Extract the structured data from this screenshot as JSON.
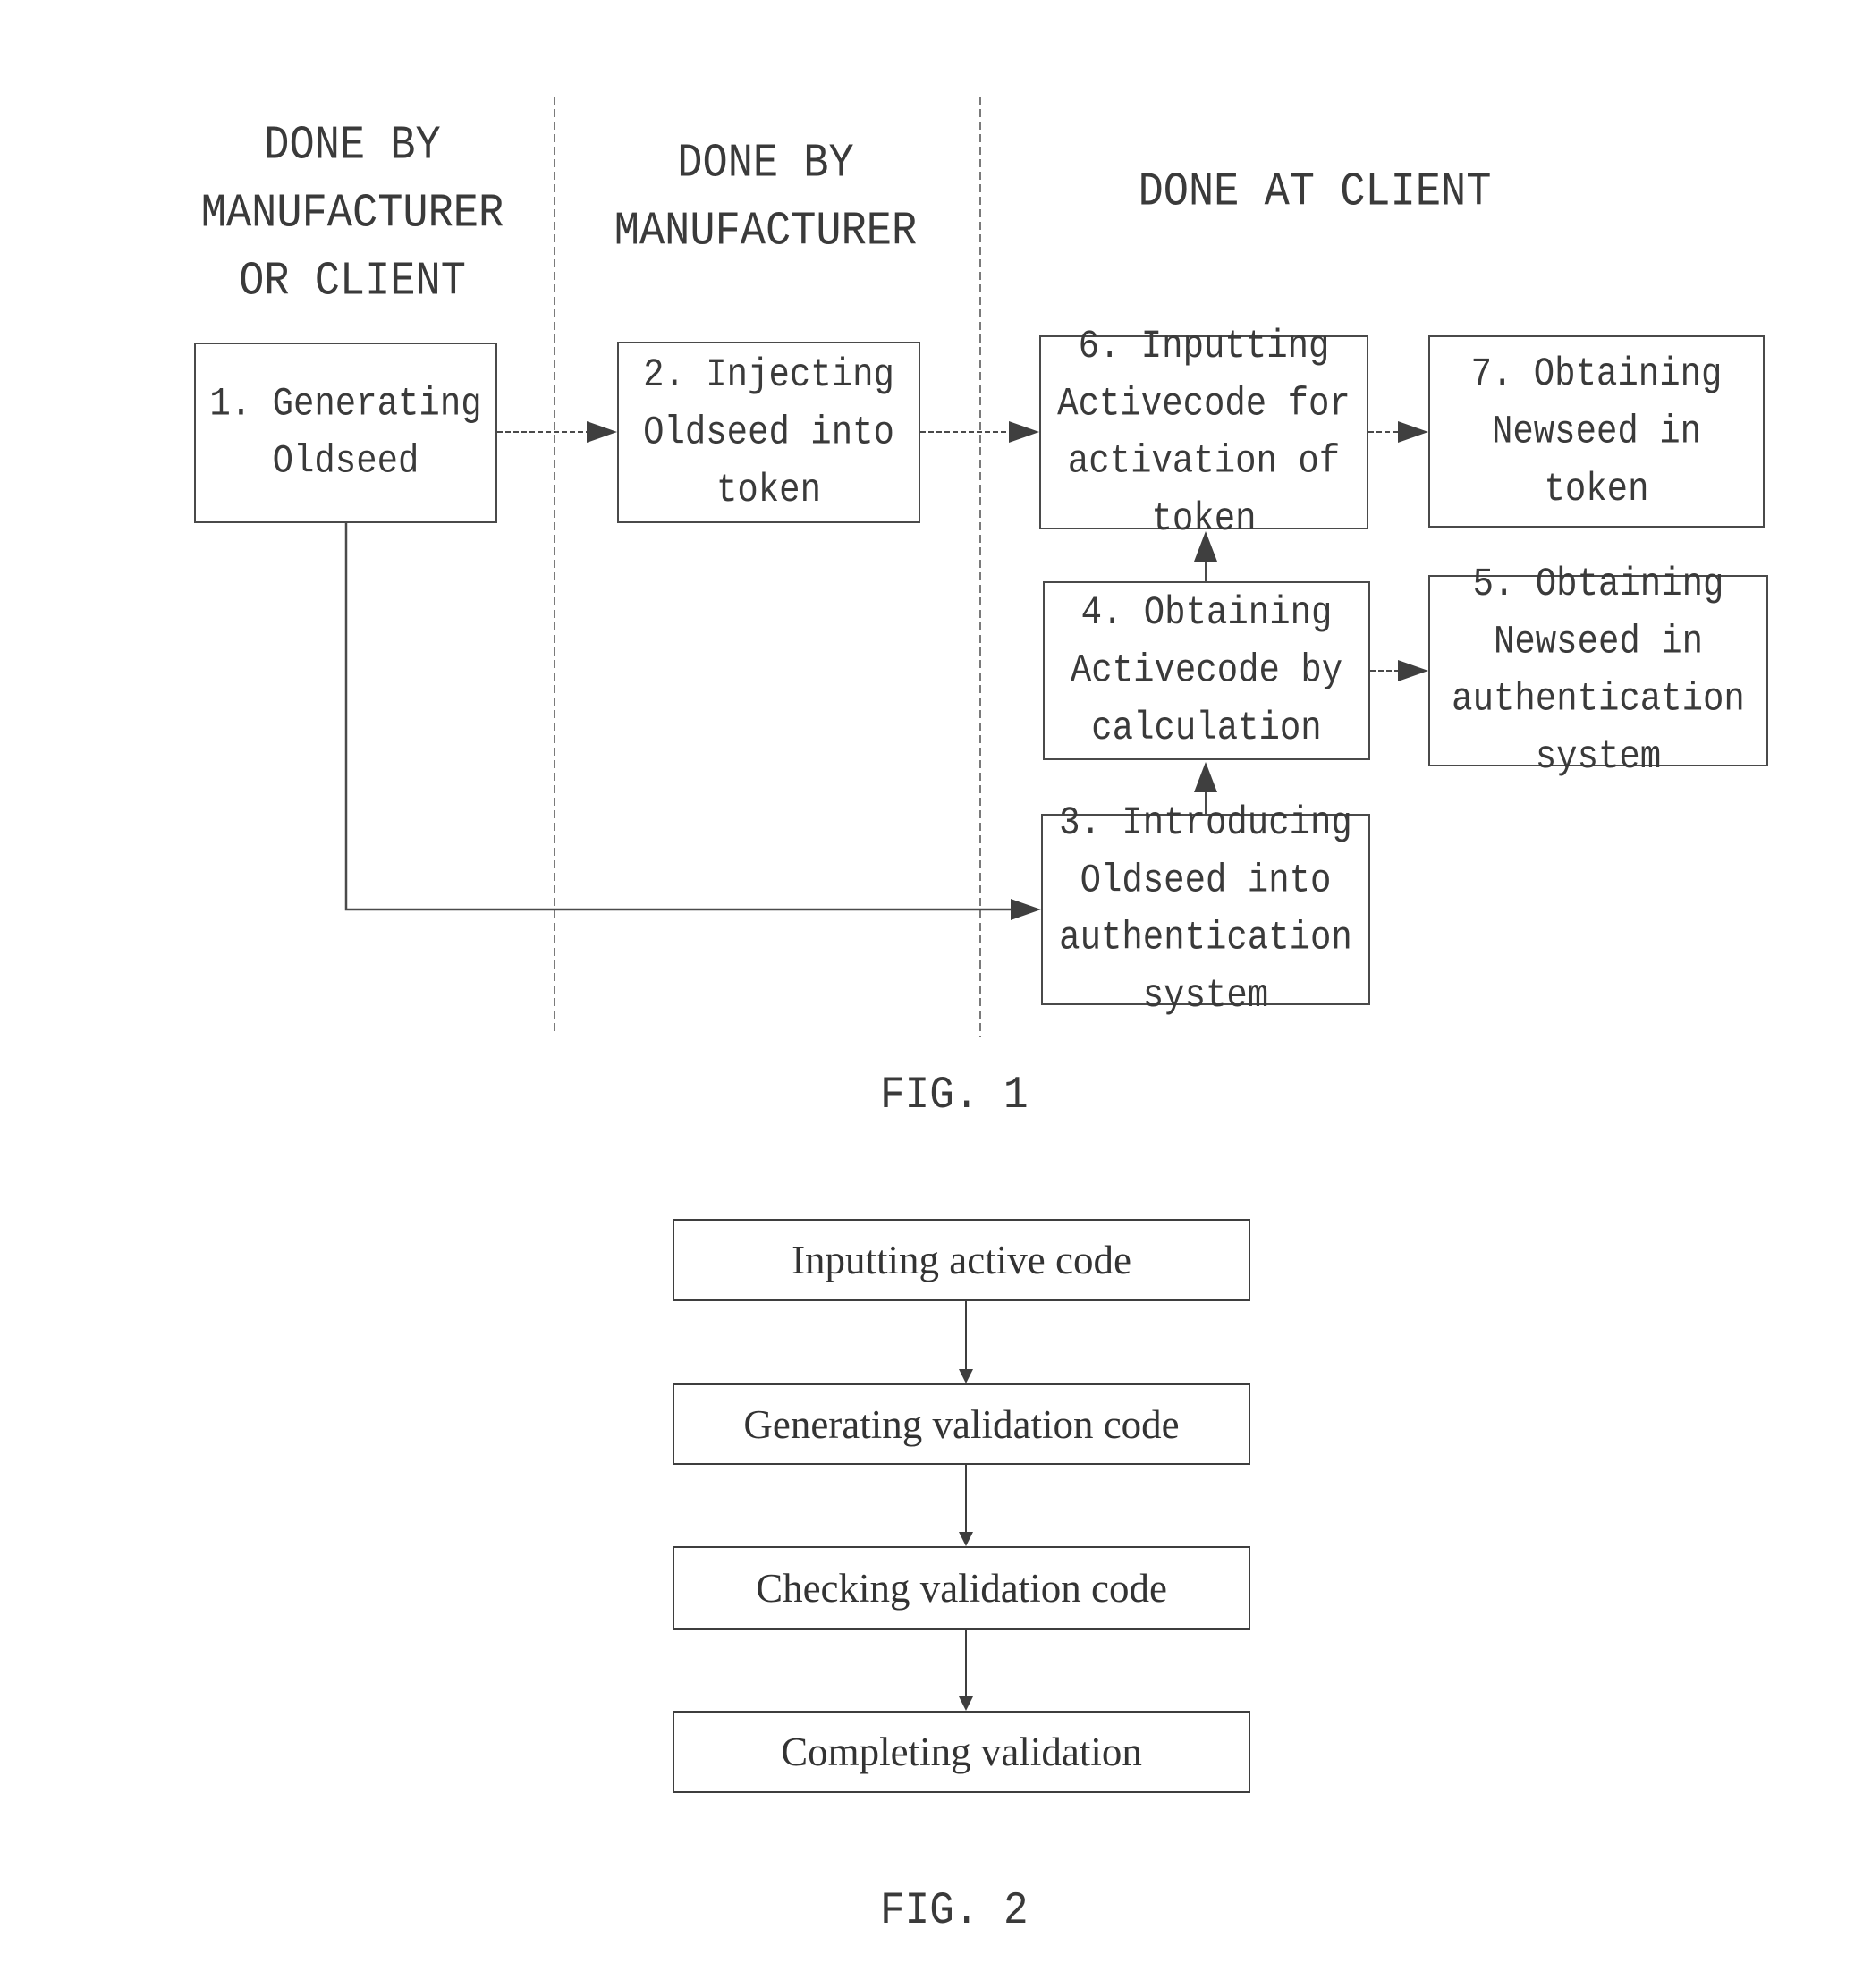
{
  "figure1": {
    "caption": "FIG. 1",
    "lanes": [
      {
        "header_lines": [
          "DONE BY",
          "MANUFACTURER",
          "OR CLIENT"
        ]
      },
      {
        "header_lines": [
          "DONE BY",
          "MANUFACTURER"
        ]
      },
      {
        "header_lines": [
          "DONE AT CLIENT"
        ]
      }
    ],
    "steps": [
      {
        "id": 1,
        "lines": [
          "1. Generating",
          "Oldseed"
        ]
      },
      {
        "id": 2,
        "lines": [
          "2. Injecting",
          "Oldseed into",
          "token"
        ]
      },
      {
        "id": 3,
        "lines": [
          "3. Introducing",
          "Oldseed into",
          "authentication",
          "system"
        ]
      },
      {
        "id": 4,
        "lines": [
          "4. Obtaining",
          "Activecode by",
          "calculation"
        ]
      },
      {
        "id": 5,
        "lines": [
          "5. Obtaining",
          "Newseed in",
          "authentication",
          "system"
        ]
      },
      {
        "id": 6,
        "lines": [
          "6. Inputting",
          "Activecode for",
          "activation of",
          "token"
        ]
      },
      {
        "id": 7,
        "lines": [
          "7. Obtaining",
          "Newseed in",
          "token"
        ]
      }
    ],
    "flows": [
      {
        "from": 1,
        "to": 2
      },
      {
        "from": 2,
        "to": 6
      },
      {
        "from": 6,
        "to": 7
      },
      {
        "from": 4,
        "to": 6
      },
      {
        "from": 4,
        "to": 5
      },
      {
        "from": 3,
        "to": 4
      },
      {
        "from": 1,
        "to": 3
      }
    ]
  },
  "figure2": {
    "caption": "FIG. 2",
    "steps": [
      "Inputting active code",
      "Generating validation code",
      "Checking validation code",
      "Completing validation"
    ],
    "flows": [
      {
        "from": 0,
        "to": 1
      },
      {
        "from": 1,
        "to": 2
      },
      {
        "from": 2,
        "to": 3
      }
    ]
  },
  "colors": {
    "line": "#4a4a4a",
    "divider": "#7a7a7a",
    "text": "#3a3a3a",
    "background": "#ffffff"
  }
}
